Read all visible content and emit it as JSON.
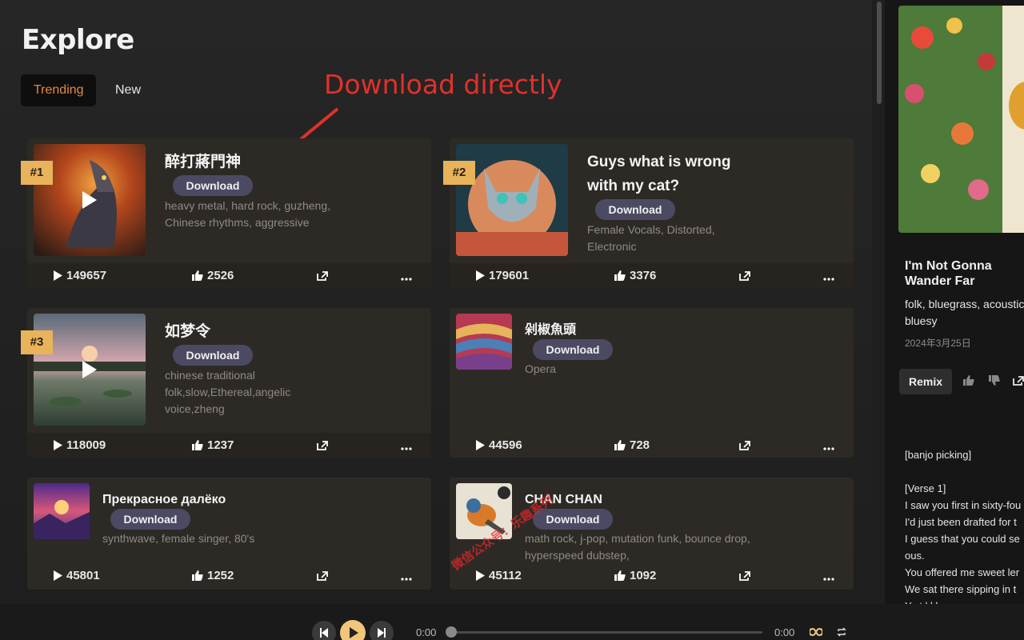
{
  "page": {
    "title": "Explore"
  },
  "tabs": [
    {
      "label": "Trending"
    },
    {
      "label": "New"
    }
  ],
  "annotation": {
    "text": "Download directly"
  },
  "cards": [
    {
      "rank": "#1",
      "title": "醉打蔣門神",
      "download_label": "Download",
      "tags": [
        "heavy metal, hard rock, guzheng,",
        "Chinese rhythms, aggressive"
      ],
      "plays": "149657",
      "likes": "2526"
    },
    {
      "rank": "#2",
      "title": "Guys what is wrong with my cat?",
      "title_lines": [
        "Guys what is wrong",
        "with my cat?"
      ],
      "download_label": "Download",
      "tags": [
        "Female Vocals, Distorted,",
        "Electronic"
      ],
      "plays": "179601",
      "likes": "3376"
    },
    {
      "rank": "#3",
      "title": "如梦令",
      "download_label": "Download",
      "tags": [
        "chinese traditional",
        "folk,slow,Ethereal,angelic",
        "voice,zheng"
      ],
      "plays": "118009",
      "likes": "1237"
    },
    {
      "title": "剁椒魚頭",
      "download_label": "Download",
      "tags": [
        "Opera"
      ],
      "plays": "44596",
      "likes": "728"
    },
    {
      "title": "Прекрасное далёко",
      "download_label": "Download",
      "tags": [
        "synthwave, female singer, 80's"
      ],
      "plays": "45801",
      "likes": "1252"
    },
    {
      "title": "CHAN CHAN",
      "download_label": "Download",
      "tags": [
        "math rock, j-pop, mutation funk, bounce drop,",
        "hyperspeed dubstep,"
      ],
      "plays": "45112",
      "likes": "1092"
    }
  ],
  "side_panel": {
    "title": "I'm Not Gonna Wander Far",
    "tags_lines": [
      "folk, bluegrass, acoustic",
      "bluesy"
    ],
    "date": "2024年3月25日",
    "remix_label": "Remix",
    "lyrics": [
      "[banjo picking]",
      "",
      "[Verse 1]",
      "I saw you first in sixty-fou",
      "I'd just been drafted for t",
      "I guess that you could se",
      "ous.",
      "You offered me sweet ler",
      "We sat there sipping in t",
      "Ye t  l     l    l"
    ]
  },
  "player": {
    "time_current": "0:00",
    "time_total": "0:00",
    "progress": 0
  },
  "watermark": {
    "text": "微信公众号：乐趣系列"
  },
  "colors": {
    "accent": "#e8893f",
    "rank_badge": "#e8b35a",
    "download_btn": "#4b4a62",
    "annotation": "#e0312b",
    "play_button": "#f1c67a"
  },
  "icons": {
    "play": "play-icon",
    "like": "thumbs-up-icon",
    "share": "share-icon",
    "more": "more-icon",
    "prev": "skip-back-icon",
    "next": "skip-forward-icon",
    "loop": "infinity-icon",
    "repeat": "repeat-icon"
  }
}
